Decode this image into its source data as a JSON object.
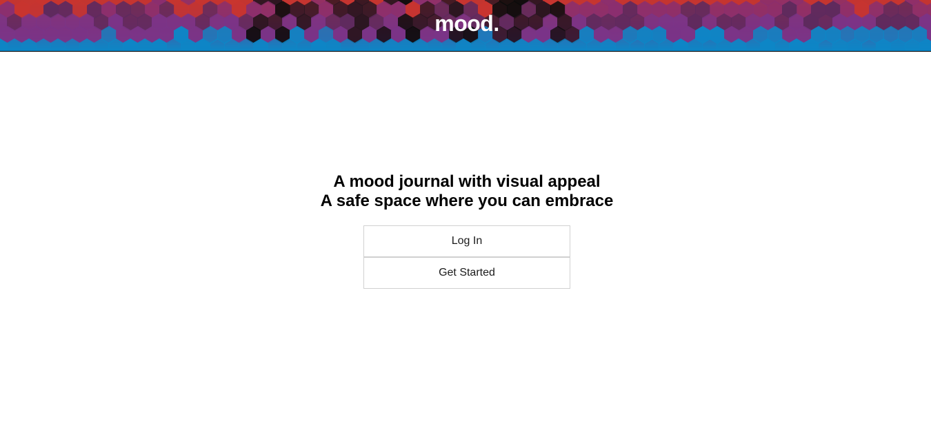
{
  "header": {
    "logo_text": "mood.",
    "banner_colors": [
      "#c8352f",
      "#8b2f6f",
      "#5e2a5e",
      "#2a1520",
      "#0c0c0c",
      "#7a3488",
      "#0d86c6"
    ]
  },
  "hero": {
    "tagline_line1": "A mood journal with visual appeal",
    "tagline_line2": "A safe space where you can embrace"
  },
  "actions": {
    "login_label": "Log In",
    "get_started_label": "Get Started"
  }
}
